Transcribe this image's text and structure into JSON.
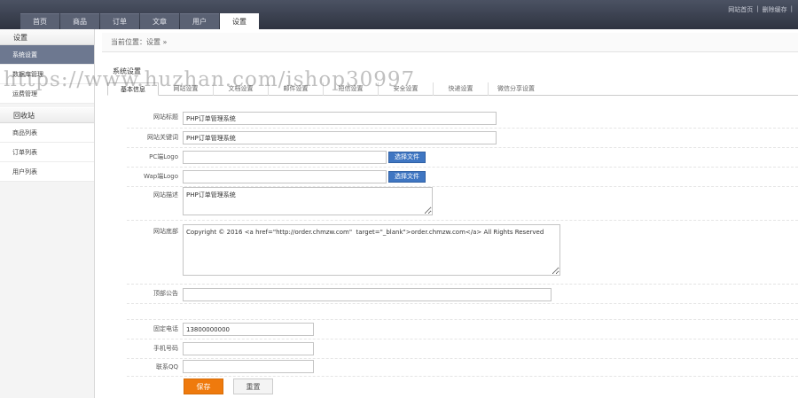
{
  "nav": {
    "tabs": [
      "首页",
      "商品",
      "订单",
      "文章",
      "用户",
      "设置"
    ],
    "active": "设置"
  },
  "top_links": {
    "site_home": "网站首页",
    "sep": "|",
    "clear_cache": "删除缓存",
    "sep2": "|"
  },
  "sidebar": {
    "groups": [
      {
        "title": "设置",
        "items": [
          "系统设置",
          "数据库管理",
          "运费管理"
        ]
      },
      {
        "title": "回收站",
        "items": [
          "商品列表",
          "订单列表",
          "用户列表"
        ]
      }
    ]
  },
  "breadcrumb": "当前位置：设置 »",
  "section_title": "系统设置",
  "sub_tabs": [
    "基本信息",
    "网站设置",
    "文档设置",
    "邮件设置",
    "短信设置",
    "安全设置",
    "快递设置",
    "微信分享设置"
  ],
  "watermark": "https://www.huzhan.com/ishop30997",
  "form": {
    "site_title": {
      "label": "网站标题",
      "value": "PHP订单管理系统"
    },
    "site_keywords": {
      "label": "网站关键词",
      "value": "PHP订单管理系统"
    },
    "pc_logo": {
      "label": "PC端Logo",
      "value": "",
      "button": "选择文件"
    },
    "wap_logo": {
      "label": "Wap端Logo",
      "value": "",
      "button": "选择文件"
    },
    "site_description": {
      "label": "网站描述",
      "value": "PHP订单管理系统"
    },
    "site_footer": {
      "label": "网站底部",
      "value": "Copyright © 2016 <a href=\"http://order.chmzw.com\"  target=\"_blank\">order.chmzw.com</a> All Rights Reserved"
    },
    "top_notice": {
      "label": "顶部公告",
      "value": ""
    },
    "phone": {
      "label": "固定电话",
      "value": "13800000000"
    },
    "mobile": {
      "label": "手机号码",
      "value": ""
    },
    "qq": {
      "label": "联系QQ",
      "value": ""
    }
  },
  "buttons": {
    "save": "保存",
    "reset": "重置"
  },
  "colors": {
    "topbar": "#2e3340",
    "sidebar_active": "#6d7890",
    "file_button": "#3f76c2",
    "save_button": "#ef7a0d"
  }
}
